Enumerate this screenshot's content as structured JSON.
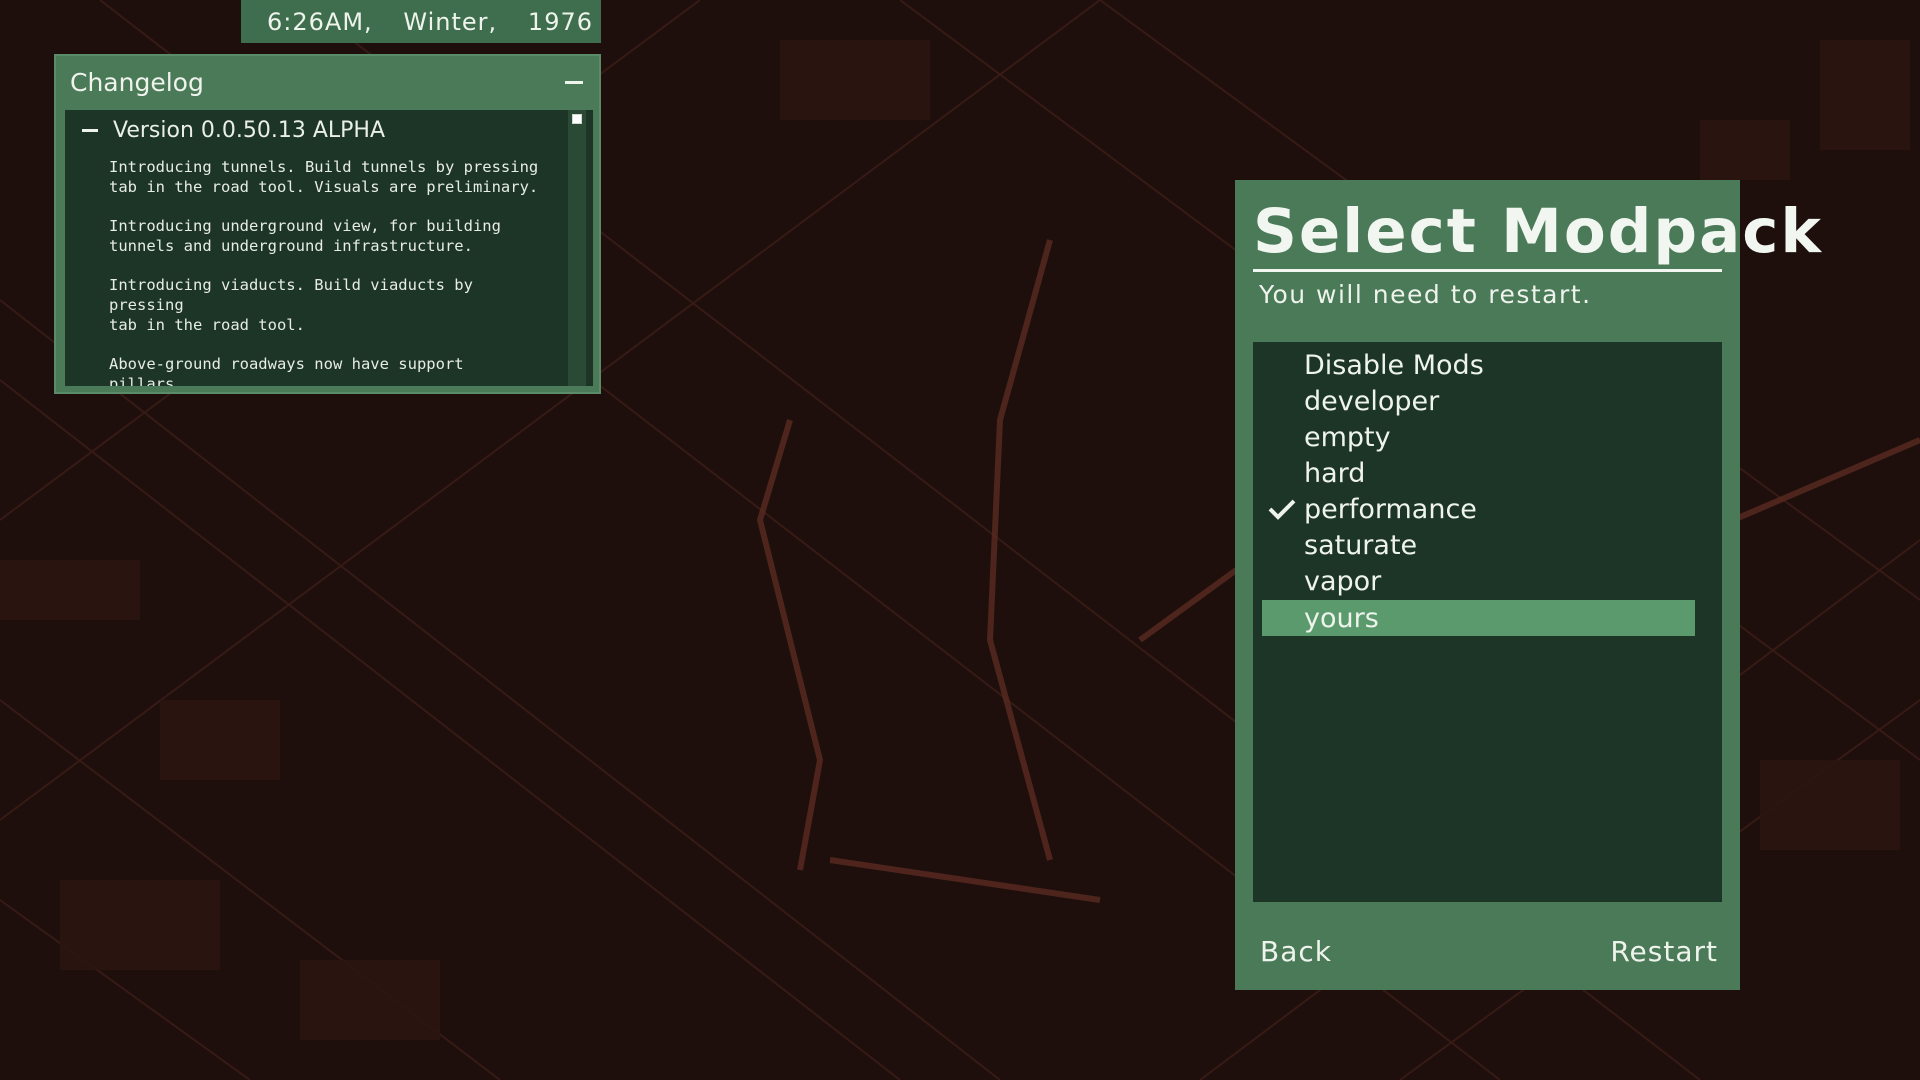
{
  "clock": {
    "time": "6:26AM,",
    "season": "Winter,",
    "year": "1976"
  },
  "changelog": {
    "title": "Changelog",
    "version": "Version 0.0.50.13 ALPHA",
    "notes": [
      "Introducing tunnels. Build tunnels by pressing\ntab in the road tool. Visuals are preliminary.",
      "Introducing underground view, for building\ntunnels and underground infrastructure.",
      "Introducing viaducts. Build viaducts by pressing\ntab in the road tool.",
      "Above-ground roadways now have support\npillars."
    ]
  },
  "modpack": {
    "title": "Select Modpack",
    "subtitle": "You will need to restart.",
    "items": [
      {
        "label": "Disable Mods",
        "checked": false,
        "selected": false
      },
      {
        "label": "developer",
        "checked": false,
        "selected": false
      },
      {
        "label": "empty",
        "checked": false,
        "selected": false
      },
      {
        "label": "hard",
        "checked": false,
        "selected": false
      },
      {
        "label": "performance",
        "checked": true,
        "selected": false
      },
      {
        "label": "saturate",
        "checked": false,
        "selected": false
      },
      {
        "label": "vapor",
        "checked": false,
        "selected": false
      },
      {
        "label": "yours",
        "checked": false,
        "selected": true
      }
    ],
    "back_label": "Back",
    "restart_label": "Restart"
  },
  "colors": {
    "panel": "#4a7a58",
    "panel_dark": "#1d3526",
    "selection": "#5a9a6d",
    "map_background": "#1e0f0c",
    "road": "#5a2a20"
  }
}
